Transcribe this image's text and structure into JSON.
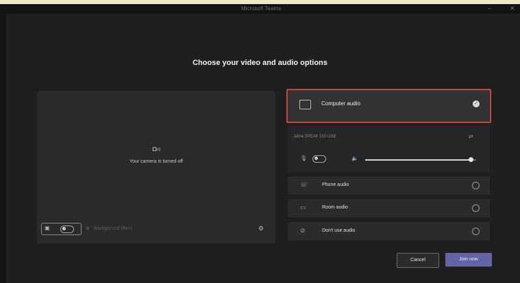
{
  "window": {
    "title": "Microsoft Teams"
  },
  "heading": "Choose your video and audio options",
  "preview": {
    "camera_status": "Your camera is turned off",
    "background_filters_label": "Background filters"
  },
  "audio_options": {
    "computer_audio": {
      "label": "Computer audio",
      "selected": true
    },
    "device": {
      "name": "Jabra SPEAK 510 USB",
      "volume_percent": 95
    },
    "phone_audio": {
      "label": "Phone audio"
    },
    "room_audio": {
      "label": "Room audio"
    },
    "dont_use_audio": {
      "label": "Don't use audio"
    }
  },
  "buttons": {
    "cancel": "Cancel",
    "join": "Join now"
  },
  "colors": {
    "accent": "#6264a7",
    "highlight_border": "#c4463f"
  }
}
